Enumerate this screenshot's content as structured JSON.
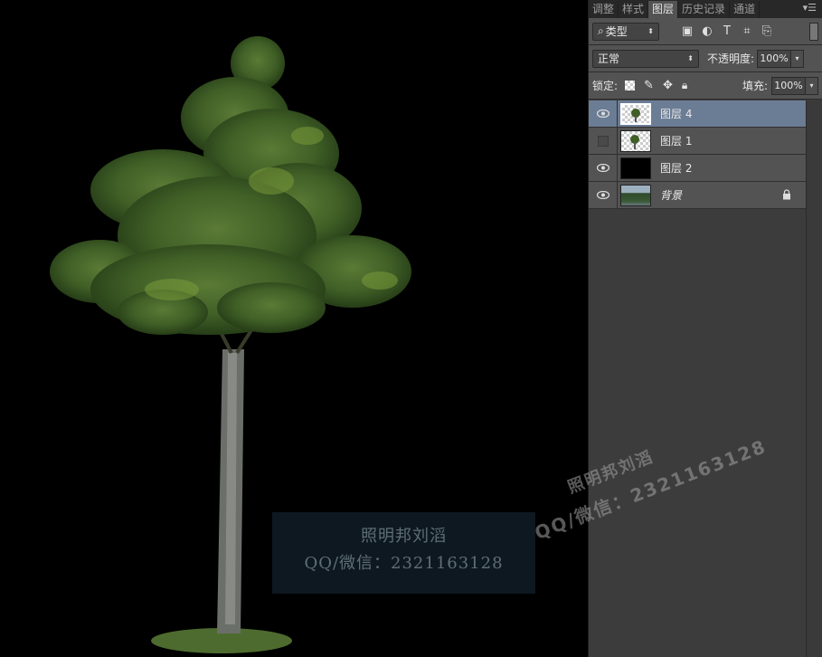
{
  "watermark_box": {
    "line1": "照明邦刘滔",
    "line2": "QQ/微信：2321163128"
  },
  "watermark_diagonal": {
    "line1": "照明邦刘滔",
    "line2": "QQ/微信：2321163128"
  },
  "panel": {
    "tabs": [
      "调整",
      "样式",
      "图层",
      "历史记录",
      "通道"
    ],
    "active_tab": "图层",
    "menu_icon": "panel-menu-icon",
    "filter": {
      "label": "类型",
      "icon": "search-icon"
    },
    "filter_icons": [
      "image-filter-icon",
      "adjustment-filter-icon",
      "text-filter-icon",
      "shape-filter-icon",
      "smart-object-filter-icon"
    ],
    "blend_mode": "正常",
    "opacity_label": "不透明度:",
    "opacity_value": "100%",
    "lock_label": "锁定:",
    "lock_icons": [
      "lock-transparent-icon",
      "lock-image-icon",
      "lock-position-icon",
      "lock-all-icon"
    ],
    "fill_label": "填充:",
    "fill_value": "100%"
  },
  "layers": [
    {
      "name": "图层 4",
      "visible": true,
      "selected": true,
      "thumb": "tree-transparent"
    },
    {
      "name": "图层 1",
      "visible": false,
      "selected": false,
      "thumb": "tree-transparent"
    },
    {
      "name": "图层 2",
      "visible": true,
      "selected": false,
      "thumb": "black"
    },
    {
      "name": "背景",
      "visible": true,
      "selected": false,
      "thumb": "photo",
      "locked": true
    }
  ],
  "colors": {
    "selected_layer": "#6b7c95",
    "panel_bg": "#535353",
    "canvas_bg": "#000000"
  }
}
